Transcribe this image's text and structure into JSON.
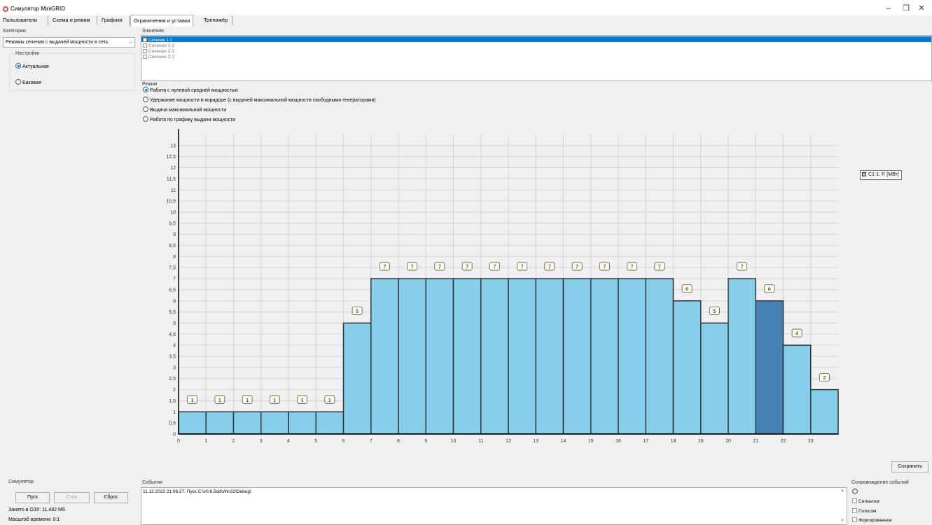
{
  "window": {
    "title": "Симулятор MiniGRID",
    "controls": {
      "minimize": "–",
      "restore": "❐",
      "close": "✕"
    }
  },
  "tabs": [
    {
      "label": "Пользователи"
    },
    {
      "label": "Схема и режим"
    },
    {
      "label": "Графики"
    },
    {
      "label": "Ограничения и уставки",
      "active": true
    },
    {
      "label": "Тренажёр"
    }
  ],
  "categories": {
    "label": "Категории",
    "combo_value": "Режимы сечения с выдачей мощности в сеть",
    "settings_label": "Настройки",
    "options": [
      {
        "label": "Актуальная",
        "selected": true
      },
      {
        "label": "Базовая",
        "selected": false
      }
    ]
  },
  "values": {
    "label": "Значения",
    "items": [
      {
        "label": "Сечение 1-1",
        "selected": true
      },
      {
        "label": "Сечение 1-2"
      },
      {
        "label": "Сечение 2-1"
      },
      {
        "label": "Сечение 2-2"
      }
    ]
  },
  "mode": {
    "label": "Режим",
    "options": [
      {
        "label": "Работа с нулевой средней мощностью",
        "selected": true
      },
      {
        "label": "Удержание мощности в коридоре (с выдачей максимальной мощности свободными генераторами)",
        "selected": false
      },
      {
        "label": "Выдача максимальной мощности",
        "selected": false
      },
      {
        "label": "Работа по графику выдачи мощности",
        "selected": false
      }
    ]
  },
  "chart_data": {
    "type": "bar",
    "x": [
      0,
      1,
      2,
      3,
      4,
      5,
      6,
      7,
      8,
      9,
      10,
      11,
      12,
      13,
      14,
      15,
      16,
      17,
      18,
      19,
      20,
      21,
      22,
      23
    ],
    "x_tick_labels": [
      "0",
      "1",
      "2",
      "3",
      "4",
      "5",
      "6",
      "7",
      "8",
      "9",
      "10",
      "11",
      "12",
      "13",
      "14",
      "15",
      "16",
      "17",
      "18",
      "19",
      "20",
      "21",
      "22",
      "23"
    ],
    "series": [
      {
        "name": "С1-1: Р, [МВт]",
        "values": [
          1,
          1,
          1,
          1,
          1,
          1,
          5,
          7,
          7,
          7,
          7,
          7,
          7,
          7,
          7,
          7,
          7,
          7,
          6,
          5,
          7,
          6,
          4,
          2
        ],
        "highlighted_index": 21
      }
    ],
    "y_tick_labels": [
      "0",
      "0,5",
      "1",
      "1,5",
      "2",
      "2,5",
      "3",
      "3,5",
      "4",
      "4,5",
      "5",
      "5,5",
      "6",
      "6,5",
      "7",
      "7,5",
      "8",
      "8,5",
      "9",
      "9,5",
      "10",
      "10,5",
      "11",
      "11,5",
      "12",
      "12,5",
      "13"
    ],
    "ylim": [
      0,
      13.5
    ],
    "xlim": [
      0,
      24
    ],
    "grid": true,
    "legend_position": "top-right",
    "colors": {
      "bar": "#87ceeb",
      "bar_highlight": "#4682b4",
      "bar_stroke": "#333333",
      "label_bg": "#fffde7"
    }
  },
  "save_button": "Сохранить",
  "simulator": {
    "label": "Симулятор",
    "start": "Пуск",
    "stop": "Стоп",
    "reset": "Сброс",
    "memory": "Занято в ОЗУ: 11,492 Мб",
    "time_scale": "Масштаб времени: 0:1"
  },
  "events": {
    "label": "События",
    "log": "11.12.2022 21:06:27: Пуск C:\\v0.6.5dd\\Win32\\Debug\\"
  },
  "notify": {
    "label": "Сопровождение событий",
    "options": [
      {
        "label": "Сигналом"
      },
      {
        "label": "Голосом"
      },
      {
        "label": "Форсированное"
      }
    ]
  }
}
